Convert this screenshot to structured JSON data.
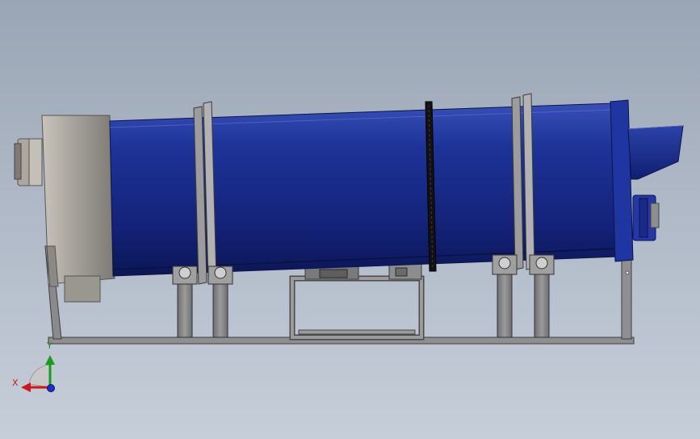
{
  "viewport": {
    "background_top": "#9aa5b5",
    "background_bottom": "#c6ced9",
    "model": {
      "subject": "rotary-drum-dryer",
      "drum_color": "#1c2f8c",
      "frame_color": "#8a8a8a"
    }
  },
  "triad": {
    "x_label": "X",
    "y_label": "Y",
    "x_color": "#d01818",
    "y_color": "#12a018",
    "z_color": "#1c2fd0"
  }
}
